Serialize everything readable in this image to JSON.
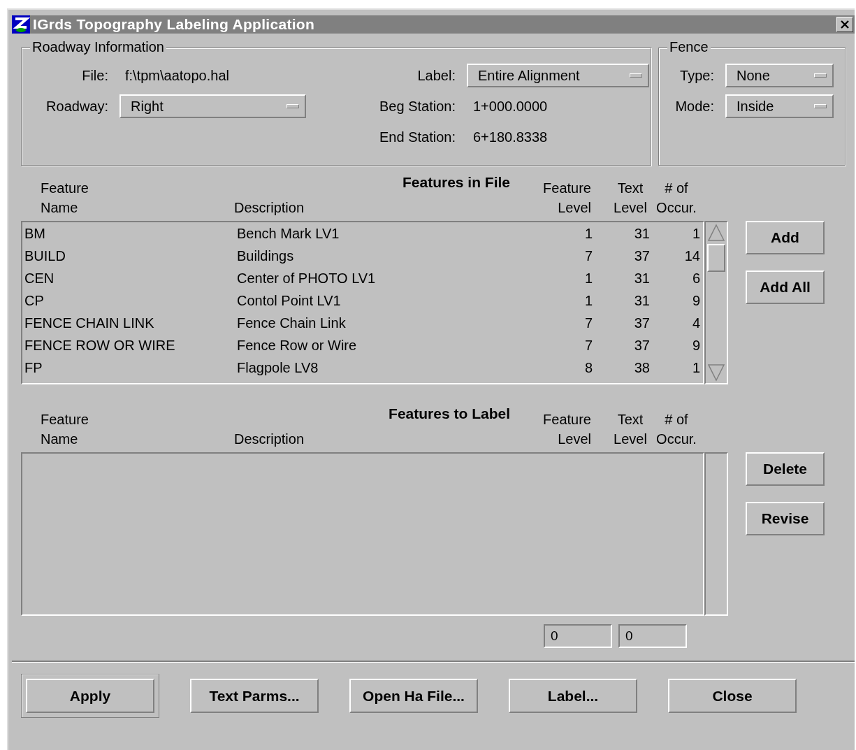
{
  "window": {
    "title": "IGrds Topography Labeling Application"
  },
  "roadway_information": {
    "title": "Roadway Information",
    "fields": [
      {
        "label": "File:",
        "value": "f:\\tpm\\aatopo.hal",
        "kind": "text"
      },
      {
        "label": "Label:",
        "value": "Entire Alignment",
        "kind": "dropdown"
      },
      {
        "label": "Roadway:",
        "value": "Right",
        "kind": "dropdown"
      },
      {
        "label": "Beg Station:",
        "value": "1+000.0000",
        "kind": "text"
      },
      {
        "label": "End Station:",
        "value": "6+180.8338",
        "kind": "text"
      }
    ]
  },
  "fence": {
    "title": "Fence",
    "fields": [
      {
        "label": "Type:",
        "value": "None",
        "kind": "dropdown"
      },
      {
        "label": "Mode:",
        "value": "Inside",
        "kind": "dropdown"
      }
    ]
  },
  "features_in_file": {
    "title": "Features in File",
    "columns": [
      "Feature\nName",
      "Description",
      "Feature\nLevel",
      "Text\nLevel",
      "# of\nOccur."
    ],
    "rows": [
      [
        "BM",
        "Bench Mark LV1",
        "1",
        "31",
        "1"
      ],
      [
        "BUILD",
        "Buildings",
        "7",
        "37",
        "14"
      ],
      [
        "CEN",
        "Center of PHOTO LV1",
        "1",
        "31",
        "6"
      ],
      [
        "CP",
        "Contol Point LV1",
        "1",
        "31",
        "9"
      ],
      [
        "FENCE CHAIN LINK",
        "Fence Chain Link",
        "7",
        "37",
        "4"
      ],
      [
        "FENCE ROW OR WIRE",
        "Fence Row or Wire",
        "7",
        "37",
        "9"
      ],
      [
        "FP",
        "Flagpole LV8",
        "8",
        "38",
        "1"
      ]
    ],
    "buttons": [
      "Add",
      "Add All"
    ]
  },
  "features_to_label": {
    "title": "Features to Label",
    "columns": [
      "Feature\nName",
      "Description",
      "Feature\nLevel",
      "Text\nLevel",
      "# of\nOccur."
    ],
    "buttons": [
      "Delete",
      "Revise"
    ]
  },
  "counters": [
    "0",
    "0"
  ],
  "buttons": [
    {
      "label": "Apply",
      "default": true
    },
    {
      "label": "Text Parms...",
      "default": false
    },
    {
      "label": "Open Ha File...",
      "default": false
    },
    {
      "label": "Label...",
      "default": false
    },
    {
      "label": "Close",
      "default": false
    }
  ]
}
